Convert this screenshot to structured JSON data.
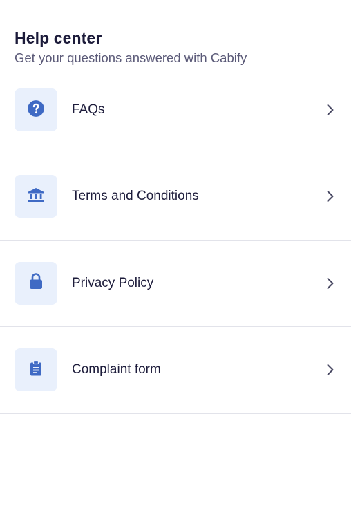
{
  "header": {
    "title": "Help center",
    "subtitle": "Get your questions answered with Cabify"
  },
  "items": [
    {
      "label": "FAQs",
      "icon": "question-circle-icon"
    },
    {
      "label": "Terms and Conditions",
      "icon": "bank-building-icon"
    },
    {
      "label": "Privacy Policy",
      "icon": "lock-icon"
    },
    {
      "label": "Complaint form",
      "icon": "clipboard-icon"
    }
  ],
  "colors": {
    "icon_tile_bg": "#e9f0fc",
    "icon_fg": "#3f6ac4",
    "divider": "#e2e3ea",
    "chevron": "#4a4a64"
  }
}
